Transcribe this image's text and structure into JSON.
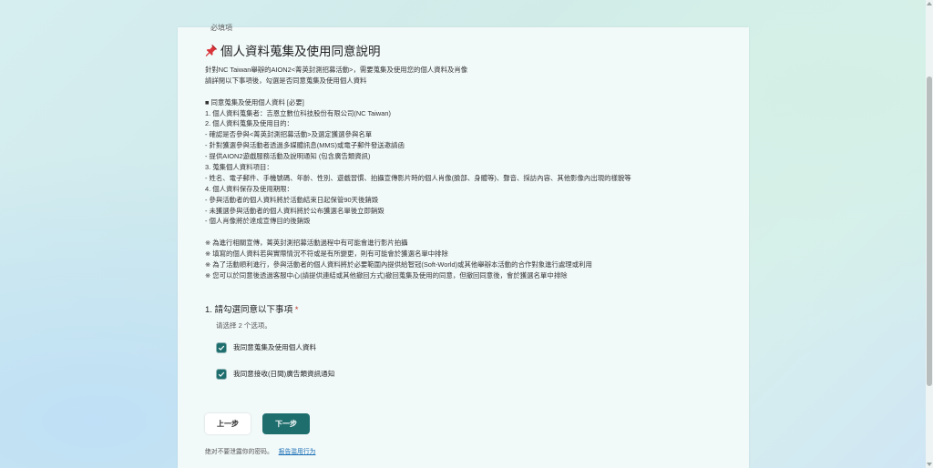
{
  "form": {
    "top_cut_text": "必填項",
    "title": "個人資料蒐集及使用同意說明",
    "intro": [
      "針對NC Taiwan舉辦的AION2<菁英封測招募活動>，需要蒐集及使用您的個人資料及肖像",
      "請詳閱以下事項後，勾選是否同意蒐集及使用個人資料"
    ],
    "sections": [
      "",
      "■ 同意蒐集及使用個人資料 [必要]",
      "1. 個人資料蒐集者：吉恩立數位科技股份有限公司(NC Taiwan)",
      "2. 個人資料蒐集及使用目的：",
      "- 確認是否參與<菁英封測招募活動>及選定獲選參與名單",
      "- 針對獲選參與活動者透過多媒體訊息(MMS)或電子郵件發送邀請函",
      "- 提供AION2遊戲服務活動及說明通知 (包含廣告類資訊)",
      "3. 蒐集個人資料項目：",
      "- 姓名、電子郵件、手機號碼、年齡、性別、遊戲習慣、拍攝宣傳影片時的個人肖像(臉部、身體等)、聲音、採訪內容、其他影像內出現的樣貌等",
      "4. 個人資料保存及使用期限：",
      "- 參與活動者的個人資料將於活動結束日起保管90天後銷毀",
      "- 未獲選參與活動者的個人資料將於公布獲選名單後立即銷毀",
      "- 個人肖像將於達成宣傳目的後銷毀",
      "",
      "※ 為進行相關宣傳，菁英封測招募活動過程中有可能會進行影片拍攝",
      "※ 填寫的個人資料若與實際情況不符或是有所變更，則有可能會於獲選名單中排除",
      "※ 為了活動順利進行，參與活動者的個人資料將於必要範圍內提供給智冠(Soft-World)或其他舉辦本活動的合作對象進行處理或利用",
      "※ 您可以於同意後透過客服中心(請提供連結或其他撤回方式)撤回蒐集及使用的同意，但撤回同意後，會於獲選名單中排除"
    ],
    "question": {
      "number_title": "1. 請勾選同意以下事項",
      "required_mark": "*",
      "hint": "请选择 2 个选项。",
      "options": [
        {
          "label": "我同意蒐集及使用個人資料",
          "checked": true
        },
        {
          "label": "我同意接收(日間)廣告類資訊通知",
          "checked": true
        }
      ]
    },
    "buttons": {
      "back": "上一步",
      "next": "下一步"
    },
    "footer": {
      "text": "绝对不要泄露你的密码。",
      "link": "报告滥用行为"
    },
    "colors": {
      "accent": "#1f6e6e",
      "link": "#1a6fb5",
      "required": "#c0392b"
    }
  }
}
